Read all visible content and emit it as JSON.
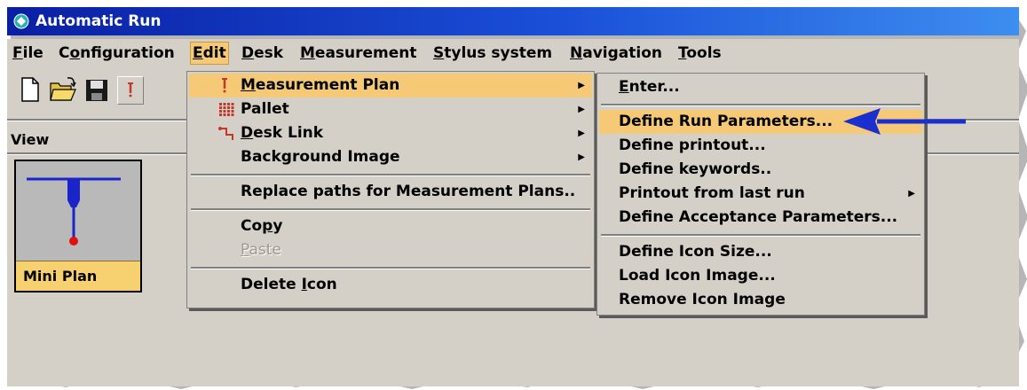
{
  "window": {
    "title": "Automatic Run"
  },
  "menubar": {
    "items": [
      {
        "label": "File",
        "u": 0
      },
      {
        "label": "Configuration",
        "u": 1
      },
      {
        "label": "Edit",
        "u": 0
      },
      {
        "label": "Desk",
        "u": 0
      },
      {
        "label": "Measurement",
        "u": 0
      },
      {
        "label": "Stylus system",
        "u": 0
      },
      {
        "label": "Navigation",
        "u": 0
      },
      {
        "label": "Tools",
        "u": 0
      }
    ],
    "active": "Edit"
  },
  "toolbar": {
    "icons": [
      "new-file-icon",
      "open-folder-icon",
      "save-disk-icon",
      "measurement-plan-icon"
    ]
  },
  "view": {
    "label": "View"
  },
  "icon_tile": {
    "label": "Mini Plan"
  },
  "edit_menu": {
    "items": [
      {
        "label": "Measurement Plan",
        "u": 0,
        "icon": "measurement-plan-icon",
        "submenu": true,
        "highlighted": true
      },
      {
        "label": "Pallet",
        "u": -1,
        "icon": "pallet-icon",
        "submenu": true
      },
      {
        "label": "Desk Link",
        "u": 0,
        "icon": "desk-link-icon",
        "submenu": true
      },
      {
        "label": "Background Image",
        "u": -1,
        "submenu": true
      },
      {
        "sep": true
      },
      {
        "label": "Replace paths for Measurement Plans..",
        "u": -1
      },
      {
        "sep": true
      },
      {
        "label": "Copy",
        "u": 2
      },
      {
        "label": "Paste",
        "u": 0,
        "disabled": true
      },
      {
        "sep": true
      },
      {
        "label": "Delete Icon",
        "u": 7
      }
    ]
  },
  "plan_submenu": {
    "items": [
      {
        "label": "Enter...",
        "u": 0
      },
      {
        "sep": true
      },
      {
        "label": "Define Run Parameters...",
        "u": -1,
        "highlighted": true
      },
      {
        "label": "Define printout...",
        "u": -1
      },
      {
        "label": "Define keywords..",
        "u": -1
      },
      {
        "label": "Printout from last run",
        "u": -1,
        "submenu": true
      },
      {
        "label": "Define Acceptance Parameters...",
        "u": -1
      },
      {
        "sep": true
      },
      {
        "label": "Define Icon Size...",
        "u": -1
      },
      {
        "label": "Load Icon Image...",
        "u": -1
      },
      {
        "label": "Remove Icon Image",
        "u": -1
      }
    ]
  },
  "colors": {
    "title_start": "#0a1fa3",
    "title_end": "#3d8ef0",
    "highlight": "#f5c976",
    "arrow": "#1a2fd0",
    "tile_label": "#f7d16f"
  }
}
